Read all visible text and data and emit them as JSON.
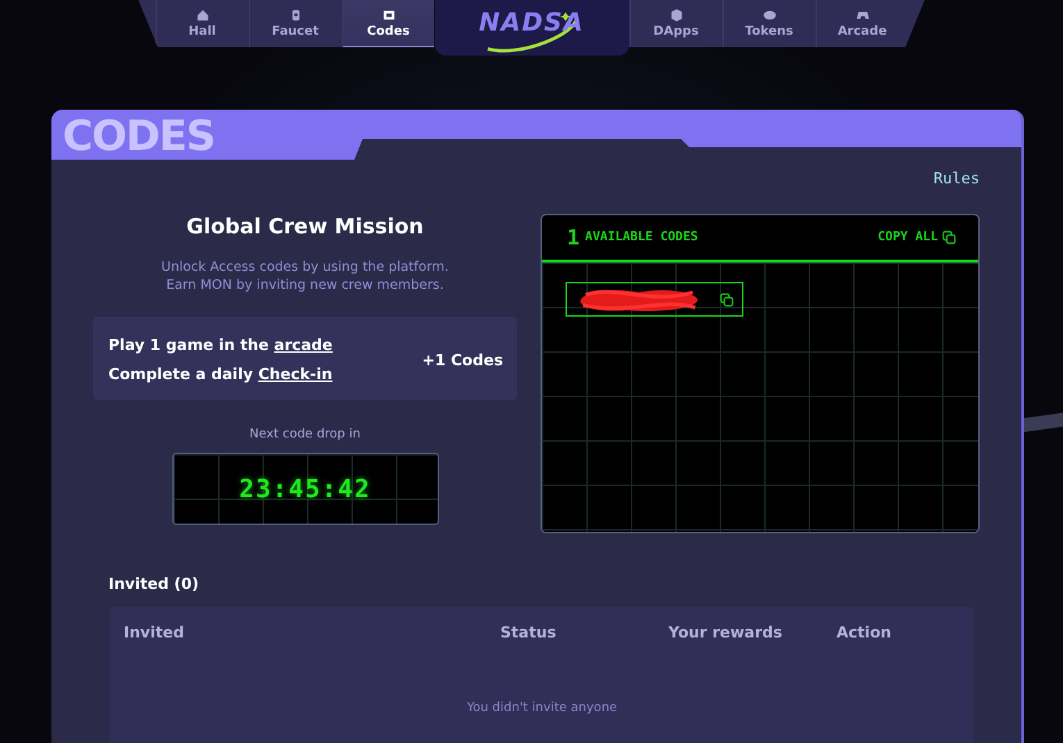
{
  "nav": {
    "tabs": [
      {
        "label": "Hall",
        "selected": false
      },
      {
        "label": "Faucet",
        "selected": false
      },
      {
        "label": "Codes",
        "selected": true
      }
    ],
    "logo": "NADSA",
    "tabs_right": [
      {
        "label": "DApps",
        "selected": false
      },
      {
        "label": "Tokens",
        "selected": false
      },
      {
        "label": "Arcade",
        "selected": false
      }
    ]
  },
  "page": {
    "title": "CODES",
    "rules_link": "Rules"
  },
  "mission": {
    "title": "Global Crew Mission",
    "description": "Unlock Access codes by using the platform.\nEarn MON by inviting new crew members.",
    "tasks": [
      {
        "text": "Play 1 game in the ",
        "link": "arcade"
      },
      {
        "text": "Complete a daily ",
        "link": "Check-in"
      }
    ],
    "reward": "+1 Codes"
  },
  "countdown": {
    "label": "Next code drop in",
    "time": "23:45:42"
  },
  "codes_panel": {
    "count": "1",
    "title": "AVAILABLE CODES",
    "copy_all": "COPY ALL",
    "codes": [
      {
        "redacted": true
      }
    ]
  },
  "invited": {
    "title": "Invited (0)",
    "columns": [
      "Invited",
      "Status",
      "Your rewards",
      "Action"
    ],
    "empty_message": "You didn't invite anyone"
  }
}
